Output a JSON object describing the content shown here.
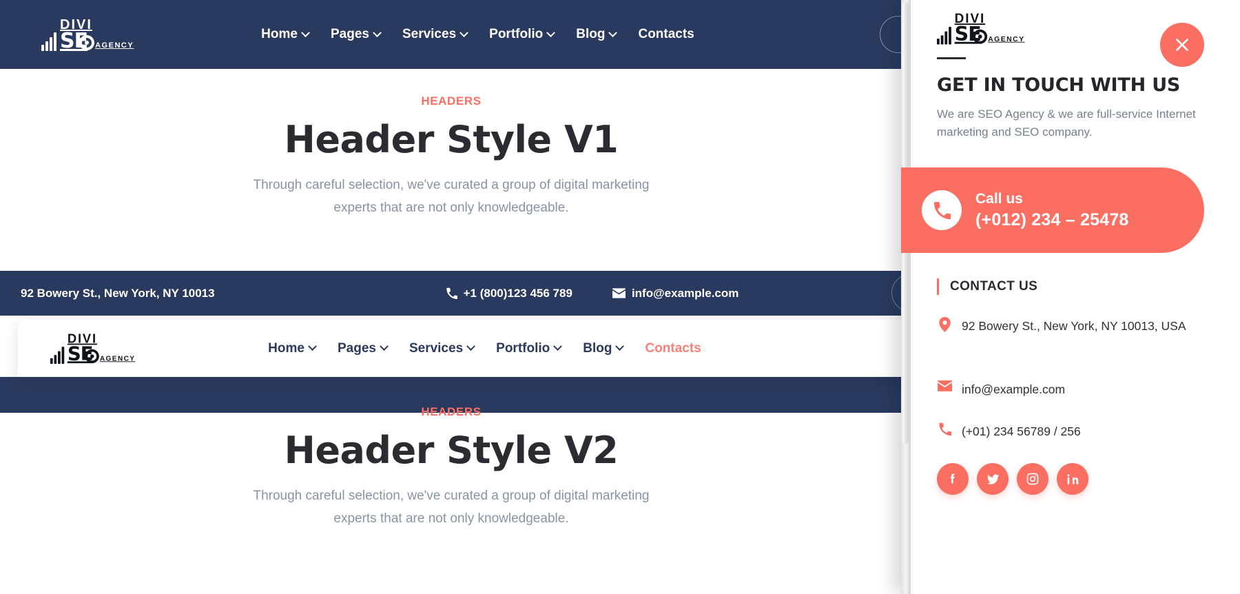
{
  "brand": {
    "logo_divi": "DIVI",
    "logo_seo": "SE",
    "logo_agency": "AGENCY",
    "navy": "#2A3A5E",
    "accent": "#FB6F63"
  },
  "topbar": {
    "menu": [
      {
        "label": "Home",
        "has_dropdown": true
      },
      {
        "label": "Pages",
        "has_dropdown": true
      },
      {
        "label": "Services",
        "has_dropdown": true
      },
      {
        "label": "Portfolio",
        "has_dropdown": true
      },
      {
        "label": "Blog",
        "has_dropdown": true
      },
      {
        "label": "Contacts",
        "has_dropdown": false
      }
    ]
  },
  "hero_v1": {
    "eyebrow": "HEADERS",
    "title": "Header Style V1",
    "line1": "Through careful selection, we've curated a group of digital marketing",
    "line2": "experts that are not only knowledgeable."
  },
  "hero_v2": {
    "eyebrow": "HEADERS",
    "title": "Header Style V2",
    "line1": "Through careful selection, we've curated a group of digital marketing",
    "line2": "experts that are not only knowledgeable."
  },
  "contactbar": {
    "address": "92 Bowery St., New York, NY 10013",
    "phone": "+1 (800)123 456 789",
    "email": "info@example.com",
    "phone_icon": "phone-icon",
    "email_icon": "envelope-icon"
  },
  "navcard": {
    "menu": [
      {
        "label": "Home",
        "has_dropdown": true,
        "active": false
      },
      {
        "label": "Pages",
        "has_dropdown": true,
        "active": false
      },
      {
        "label": "Services",
        "has_dropdown": true,
        "active": false
      },
      {
        "label": "Portfolio",
        "has_dropdown": true,
        "active": false
      },
      {
        "label": "Blog",
        "has_dropdown": true,
        "active": false
      },
      {
        "label": "Contacts",
        "has_dropdown": false,
        "active": true
      }
    ]
  },
  "panel": {
    "close_icon": "close-icon",
    "heading": "GET IN TOUCH WITH US",
    "intro": "We are SEO Agency & we are full-service Internet marketing and SEO company.",
    "call": {
      "icon": "phone-icon",
      "label": "Call us",
      "number": "(+012) 234 – 25478"
    },
    "contact_title": "CONTACT US",
    "address": "92 Bowery St., New York, NY 10013, USA",
    "address_icon": "map-pin-icon",
    "email": "info@example.com",
    "email_icon": "envelope-icon",
    "phone": "(+01) 234 56789 / 256",
    "phone_icon": "phone-icon",
    "socials": [
      {
        "name": "facebook-icon",
        "glyph": "f"
      },
      {
        "name": "twitter-icon",
        "glyph": "t"
      },
      {
        "name": "instagram-icon",
        "glyph": "i"
      },
      {
        "name": "linkedin-icon",
        "glyph": "in"
      }
    ]
  }
}
